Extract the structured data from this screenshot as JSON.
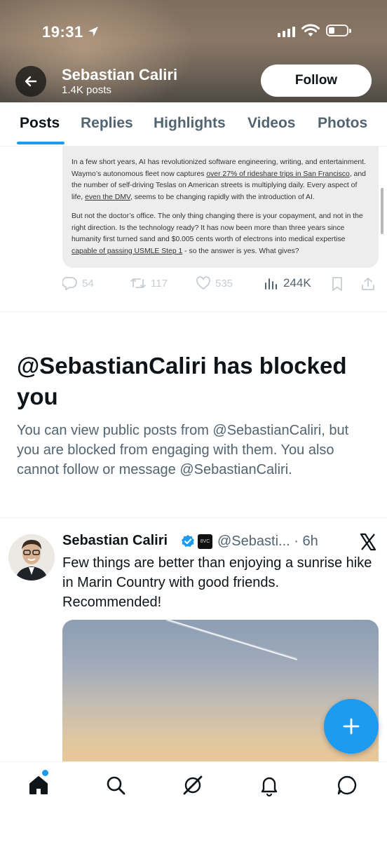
{
  "status_bar": {
    "time": "19:31"
  },
  "profile": {
    "name": "Sebastian Caliri",
    "posts_count": "1.4K posts",
    "follow_label": "Follow"
  },
  "tabs": [
    {
      "label": "Posts",
      "active": true
    },
    {
      "label": "Replies"
    },
    {
      "label": "Highlights"
    },
    {
      "label": "Videos"
    },
    {
      "label": "Photos"
    }
  ],
  "quoted_article": {
    "p1_a": "In a few short years, AI has revolutionized software engineering, writing, and entertainment. Waymo’s autonomous fleet now captures ",
    "p1_link1": "over 27% of rideshare trips in San Francisco",
    "p1_b": ", and the number of self-driving Teslas on American streets is multiplying daily. Every aspect of life, ",
    "p1_link2": "even the DMV",
    "p1_c": ", seems to be changing rapidly with the introduction of AI.",
    "p2_a": "But not the doctor’s office. The only thing changing there is your copayment, and not in the right direction. Is the technology ready? It has now been more than three years since humanity first turned sand and $0.005 cents worth of electrons into medical expertise ",
    "p2_link": "capable of passing USMLE Step 1",
    "p2_b": " - so the answer is yes. What gives?"
  },
  "post_actions": {
    "replies": "54",
    "reposts": "117",
    "likes": "535",
    "views": "244K"
  },
  "blocked_notice": {
    "title": "@SebastianCaliri has blocked you",
    "body": "You can view public posts from @SebastianCaliri, but you are blocked from engaging with them. You also cannot follow or message @SebastianCaliri."
  },
  "tweet": {
    "author": "Sebastian Caliri",
    "org_badge": "8VC",
    "handle_time": "@Sebasti... · 6h",
    "text": "Few things are better than enjoying a sunrise hike in Marin Country with good friends. Recommended!"
  },
  "colors": {
    "accent": "#1d9bf0",
    "text": "#0f1419",
    "secondary": "#536471"
  },
  "icons": [
    "back-arrow-icon",
    "location-arrow-icon",
    "signal-icon",
    "wifi-icon",
    "battery-icon",
    "reply-icon",
    "repost-icon",
    "like-icon",
    "views-icon",
    "bookmark-icon",
    "share-icon",
    "verified-icon",
    "x-logo-icon",
    "plus-icon",
    "home-icon",
    "search-icon",
    "grok-icon",
    "bell-icon",
    "messages-icon"
  ]
}
